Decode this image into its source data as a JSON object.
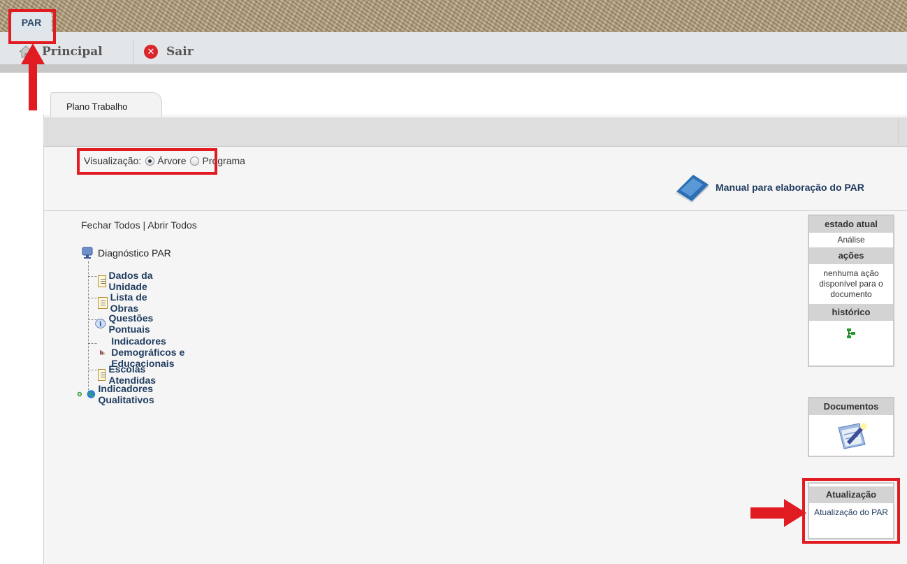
{
  "header": {
    "system_tab": "PAR"
  },
  "menu": {
    "principal": "Principal",
    "sair": "Sair"
  },
  "tabs": {
    "plano": "Plano Trabalho"
  },
  "view": {
    "label": "Visualização:",
    "option_arvore": "Árvore",
    "option_programa": "Programa",
    "selected": "Árvore"
  },
  "manual_link": "Manual para elaboração do PAR",
  "tree": {
    "fechar": "Fechar Todos",
    "separator": "|",
    "abrir": "Abrir Todos",
    "root": "Diagnóstico PAR",
    "children": [
      "Dados da Unidade",
      "Lista de Obras",
      "Questões Pontuais",
      "Indicadores Demográficos e Educacionais",
      "Escolas Atendidas"
    ],
    "second_root": "Indicadores Qualitativos"
  },
  "state_box": {
    "estado_header": "estado atual",
    "estado_value": "Análise",
    "acoes_header": "ações",
    "acoes_value": "nenhuma ação disponível para o documento",
    "historico_header": "histórico"
  },
  "documents_box": {
    "header": "Documentos"
  },
  "atualizacao_box": {
    "header": "Atualização",
    "link": "Atualização do PAR"
  },
  "colors": {
    "highlight": "#e11b22",
    "link": "#1f3b5f",
    "panel": "#f5f5f5"
  },
  "icons": [
    "home-icon",
    "close-circle-icon",
    "book-icon",
    "monitor-icon",
    "doc-icon",
    "info-icon",
    "chart-icon",
    "globe-icon",
    "plus-icon",
    "hierarchy-icon",
    "document-pen-icon"
  ]
}
